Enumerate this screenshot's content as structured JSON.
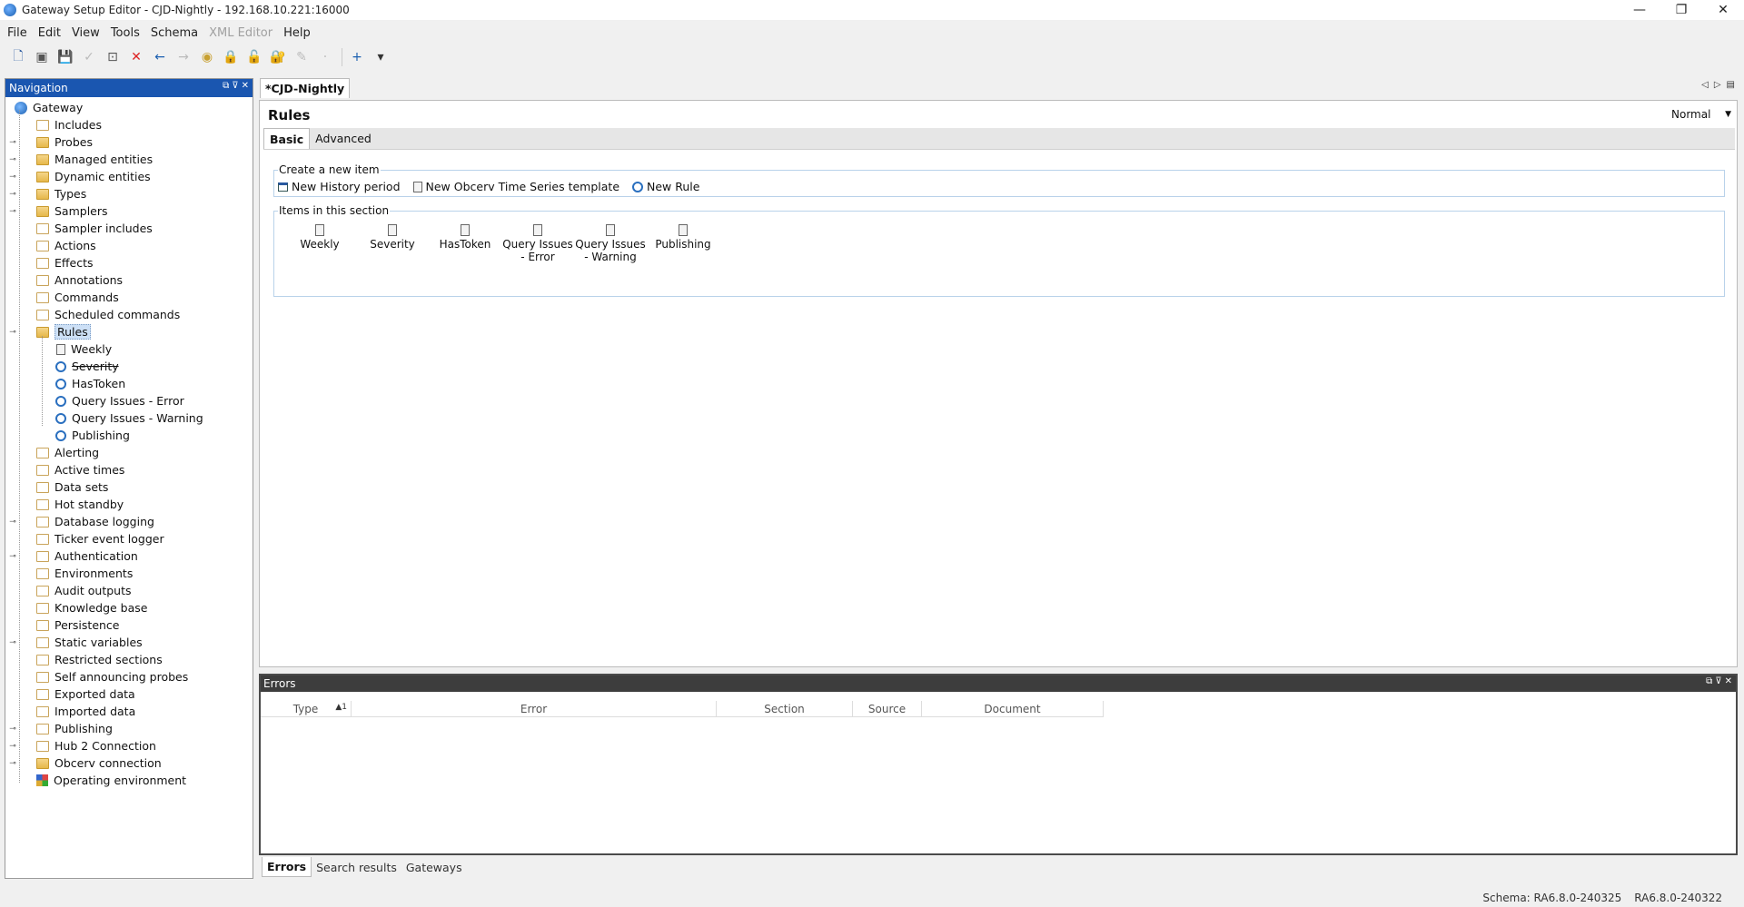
{
  "window": {
    "title": "Gateway Setup Editor - CJD-Nightly - 192.168.10.221:16000",
    "controls": {
      "minimize": "—",
      "restore": "❐",
      "close": "✕"
    }
  },
  "menu": {
    "items": [
      {
        "label": "File",
        "enabled": true
      },
      {
        "label": "Edit",
        "enabled": true
      },
      {
        "label": "View",
        "enabled": true
      },
      {
        "label": "Tools",
        "enabled": true
      },
      {
        "label": "Schema",
        "enabled": true
      },
      {
        "label": "XML Editor",
        "enabled": false
      },
      {
        "label": "Help",
        "enabled": true
      }
    ]
  },
  "toolbar": {
    "buttons": [
      {
        "icon": "new-document-icon",
        "glyph": "🗋",
        "color": "#2a5aa0",
        "enabled": true
      },
      {
        "icon": "open-icon",
        "glyph": "▣",
        "color": "#555",
        "enabled": true
      },
      {
        "icon": "save-icon",
        "glyph": "💾",
        "color": "#1b5fb0",
        "enabled": true
      },
      {
        "icon": "validate-icon",
        "glyph": "✓",
        "color": "#bbb",
        "enabled": false
      },
      {
        "icon": "find-icon",
        "glyph": "⊡",
        "color": "#555",
        "enabled": true
      },
      {
        "icon": "delete-icon",
        "glyph": "✕",
        "color": "#d22",
        "enabled": true
      },
      {
        "icon": "back-icon",
        "glyph": "←",
        "color": "#1b5fb0",
        "enabled": true
      },
      {
        "icon": "forward-icon",
        "glyph": "→",
        "color": "#bbb",
        "enabled": false
      },
      {
        "icon": "preview-icon",
        "glyph": "◉",
        "color": "#c8a030",
        "enabled": true
      },
      {
        "icon": "lock-icon",
        "glyph": "🔒",
        "color": "#555",
        "enabled": true
      },
      {
        "icon": "unlock-icon",
        "glyph": "🔓",
        "color": "#bbb",
        "enabled": false
      },
      {
        "icon": "lock-settings-icon",
        "glyph": "🔐",
        "color": "#555",
        "enabled": true
      },
      {
        "icon": "edit-icon",
        "glyph": "✎",
        "color": "#bbb",
        "enabled": false
      },
      {
        "icon": "zoom-icon",
        "glyph": "·",
        "color": "#bbb",
        "enabled": false
      },
      {
        "icon": "add-icon",
        "glyph": "+",
        "color": "#1b5fb0",
        "enabled": true
      },
      {
        "icon": "dropdown-icon",
        "glyph": "▾",
        "color": "#333",
        "enabled": true
      }
    ]
  },
  "navigation": {
    "title": "Navigation",
    "tree": [
      {
        "label": "Gateway",
        "icon": "gateway-icon",
        "type": "gateway",
        "depth": 0,
        "expander": ""
      },
      {
        "label": "Includes",
        "icon": "folder-empty-icon",
        "type": "folder-empty",
        "depth": 1,
        "expander": ""
      },
      {
        "label": "Probes",
        "icon": "folder-icon",
        "type": "folder",
        "depth": 1,
        "expander": "o-"
      },
      {
        "label": "Managed entities",
        "icon": "folder-icon",
        "type": "folder",
        "depth": 1,
        "expander": "o-"
      },
      {
        "label": "Dynamic entities",
        "icon": "folder-icon",
        "type": "folder",
        "depth": 1,
        "expander": "o-"
      },
      {
        "label": "Types",
        "icon": "folder-icon",
        "type": "folder",
        "depth": 1,
        "expander": "o-"
      },
      {
        "label": "Samplers",
        "icon": "folder-icon",
        "type": "folder",
        "depth": 1,
        "expander": "o-"
      },
      {
        "label": "Sampler includes",
        "icon": "folder-empty-icon",
        "type": "folder-empty",
        "depth": 1,
        "expander": ""
      },
      {
        "label": "Actions",
        "icon": "folder-empty-icon",
        "type": "folder-empty",
        "depth": 1,
        "expander": ""
      },
      {
        "label": "Effects",
        "icon": "folder-empty-icon",
        "type": "folder-empty",
        "depth": 1,
        "expander": ""
      },
      {
        "label": "Annotations",
        "icon": "folder-empty-icon",
        "type": "folder-empty",
        "depth": 1,
        "expander": ""
      },
      {
        "label": "Commands",
        "icon": "folder-empty-icon",
        "type": "folder-empty",
        "depth": 1,
        "expander": ""
      },
      {
        "label": "Scheduled commands",
        "icon": "folder-empty-icon",
        "type": "folder-empty",
        "depth": 1,
        "expander": ""
      },
      {
        "label": "Rules",
        "icon": "folder-icon",
        "type": "folder",
        "depth": 1,
        "expander": "o|",
        "selected": true
      },
      {
        "label": "Weekly",
        "icon": "document-icon",
        "type": "doc",
        "depth": 2,
        "expander": ""
      },
      {
        "label": "Severity",
        "icon": "rule-icon",
        "type": "rule",
        "depth": 2,
        "expander": "",
        "strike": true
      },
      {
        "label": "HasToken",
        "icon": "rule-icon",
        "type": "rule",
        "depth": 2,
        "expander": ""
      },
      {
        "label": "Query Issues - Error",
        "icon": "rule-icon",
        "type": "rule",
        "depth": 2,
        "expander": ""
      },
      {
        "label": "Query Issues - Warning",
        "icon": "rule-icon",
        "type": "rule",
        "depth": 2,
        "expander": ""
      },
      {
        "label": "Publishing",
        "icon": "rule-icon",
        "type": "rule",
        "depth": 2,
        "expander": ""
      },
      {
        "label": "Alerting",
        "icon": "folder-empty-icon",
        "type": "folder-empty",
        "depth": 1,
        "expander": ""
      },
      {
        "label": "Active times",
        "icon": "folder-empty-icon",
        "type": "folder-empty",
        "depth": 1,
        "expander": ""
      },
      {
        "label": "Data sets",
        "icon": "folder-empty-icon",
        "type": "folder-empty",
        "depth": 1,
        "expander": ""
      },
      {
        "label": "Hot standby",
        "icon": "folder-empty-icon",
        "type": "folder-empty",
        "depth": 1,
        "expander": ""
      },
      {
        "label": "Database logging",
        "icon": "folder-empty-icon",
        "type": "folder-empty",
        "depth": 1,
        "expander": "o-"
      },
      {
        "label": "Ticker event logger",
        "icon": "folder-empty-icon",
        "type": "folder-empty",
        "depth": 1,
        "expander": ""
      },
      {
        "label": "Authentication",
        "icon": "folder-empty-icon",
        "type": "folder-empty",
        "depth": 1,
        "expander": "o-"
      },
      {
        "label": "Environments",
        "icon": "folder-empty-icon",
        "type": "folder-empty",
        "depth": 1,
        "expander": ""
      },
      {
        "label": "Audit outputs",
        "icon": "folder-empty-icon",
        "type": "folder-empty",
        "depth": 1,
        "expander": ""
      },
      {
        "label": "Knowledge base",
        "icon": "folder-empty-icon",
        "type": "folder-empty",
        "depth": 1,
        "expander": ""
      },
      {
        "label": "Persistence",
        "icon": "folder-empty-icon",
        "type": "folder-empty",
        "depth": 1,
        "expander": ""
      },
      {
        "label": "Static variables",
        "icon": "folder-empty-icon",
        "type": "folder-empty",
        "depth": 1,
        "expander": "o-"
      },
      {
        "label": "Restricted sections",
        "icon": "folder-empty-icon",
        "type": "folder-empty",
        "depth": 1,
        "expander": ""
      },
      {
        "label": "Self announcing probes",
        "icon": "folder-empty-icon",
        "type": "folder-empty",
        "depth": 1,
        "expander": ""
      },
      {
        "label": "Exported data",
        "icon": "folder-empty-icon",
        "type": "folder-empty",
        "depth": 1,
        "expander": ""
      },
      {
        "label": "Imported data",
        "icon": "folder-empty-icon",
        "type": "folder-empty",
        "depth": 1,
        "expander": ""
      },
      {
        "label": "Publishing",
        "icon": "folder-empty-icon",
        "type": "folder-empty",
        "depth": 1,
        "expander": "o-"
      },
      {
        "label": "Hub 2 Connection",
        "icon": "folder-empty-icon",
        "type": "folder-empty",
        "depth": 1,
        "expander": "o-"
      },
      {
        "label": "Obcerv connection",
        "icon": "folder-icon",
        "type": "folder",
        "depth": 1,
        "expander": "o-"
      },
      {
        "label": "Operating environment",
        "icon": "environment-icon",
        "type": "env",
        "depth": 1,
        "expander": ""
      }
    ]
  },
  "document_tab": {
    "label": "*CJD-Nightly"
  },
  "main": {
    "title": "Rules",
    "mode": "Normal",
    "tabs": [
      {
        "label": "Basic",
        "active": true
      },
      {
        "label": "Advanced",
        "active": false
      }
    ],
    "create_section": {
      "title": "Create a new item",
      "items": [
        {
          "label": "New History period",
          "icon": "history-period-icon"
        },
        {
          "label": "New Obcerv Time Series template",
          "icon": "document-icon"
        },
        {
          "label": "New Rule",
          "icon": "rule-icon"
        }
      ]
    },
    "items_section": {
      "title": "Items in this section",
      "items": [
        {
          "label": "Weekly"
        },
        {
          "label": "Severity"
        },
        {
          "label": "HasToken"
        },
        {
          "label": "Query Issues - Error"
        },
        {
          "label": "Query Issues - Warning"
        },
        {
          "label": "Publishing"
        }
      ]
    }
  },
  "errors": {
    "title": "Errors",
    "columns": [
      "Type",
      "Error",
      "Section",
      "Source",
      "Document"
    ],
    "sort_indicator": "▲1",
    "rows": []
  },
  "bottom_tabs": [
    {
      "label": "Errors",
      "active": true
    },
    {
      "label": "Search results",
      "active": false
    },
    {
      "label": "Gateways",
      "active": false
    }
  ],
  "status": {
    "schema": "Schema: RA6.8.0-240325",
    "version": "RA6.8.0-240322"
  }
}
